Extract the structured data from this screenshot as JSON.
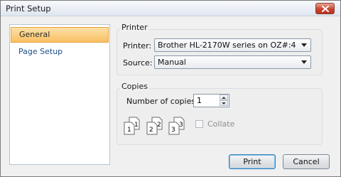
{
  "window": {
    "title": "Print Setup"
  },
  "sidebar": {
    "items": [
      {
        "label": "General",
        "selected": true
      },
      {
        "label": "Page Setup",
        "selected": false
      }
    ]
  },
  "printer_group": {
    "title": "Printer",
    "printer_label": "Printer:",
    "printer_value": "Brother HL-2170W series on OZ#:4",
    "source_label": "Source:",
    "source_value": "Manual"
  },
  "copies_group": {
    "title": "Copies",
    "number_label": "Number of copies:",
    "number_value": "1",
    "collate_label": "Collate",
    "collate_checked": false,
    "collate_icons": [
      {
        "front": "1",
        "back": "1"
      },
      {
        "front": "2",
        "back": "2"
      },
      {
        "front": "3",
        "back": "3"
      }
    ]
  },
  "buttons": {
    "print": "Print",
    "cancel": "Cancel"
  },
  "colors": {
    "selected_item": "#f9c063",
    "link_text": "#1d4c8a",
    "close_button": "#c9452f",
    "default_button_border": "#3c7fb1"
  }
}
